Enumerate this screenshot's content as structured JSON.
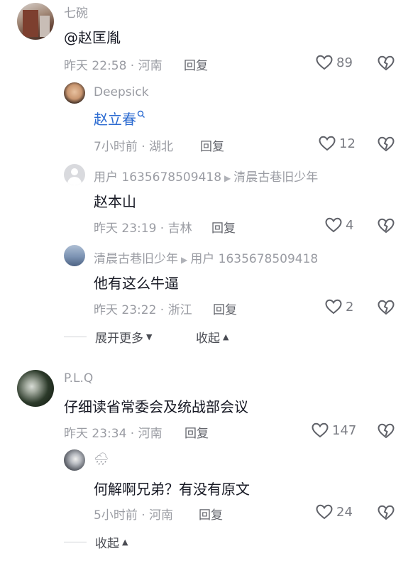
{
  "comments": [
    {
      "user": "七碗",
      "text": "@赵匡胤",
      "time": "昨天 22:58",
      "location": "河南",
      "reply_label": "回复",
      "likes": "89",
      "replies": [
        {
          "user": "Deepsick",
          "text": "赵立春",
          "time": "7小时前",
          "location": "湖北",
          "reply_label": "回复",
          "likes": "12"
        },
        {
          "user": "用户 1635678509418",
          "reply_to": "清晨古巷旧少年",
          "text": "赵本山",
          "time": "昨天 23:19",
          "location": "吉林",
          "reply_label": "回复",
          "likes": "4"
        },
        {
          "user": "清晨古巷旧少年",
          "reply_to": "用户 1635678509418",
          "text": "他有这么牛逼",
          "time": "昨天 23:22",
          "location": "浙江",
          "reply_label": "回复",
          "likes": "2"
        }
      ],
      "expand_more": "展开更多",
      "collapse": "收起"
    },
    {
      "user": "P.L.Q",
      "text": "仔细读省常委会及统战部会议",
      "time": "昨天 23:34",
      "location": "河南",
      "reply_label": "回复",
      "likes": "147",
      "replies": [
        {
          "user": "🌧",
          "text": "何解啊兄弟？有没有原文",
          "time": "5小时前",
          "location": "河南",
          "reply_label": "回复",
          "likes": "24"
        }
      ],
      "collapse": "收起"
    }
  ],
  "colors": {
    "link": "#2c6bd1",
    "muted": "#9a9ca3",
    "text": "#161823"
  }
}
